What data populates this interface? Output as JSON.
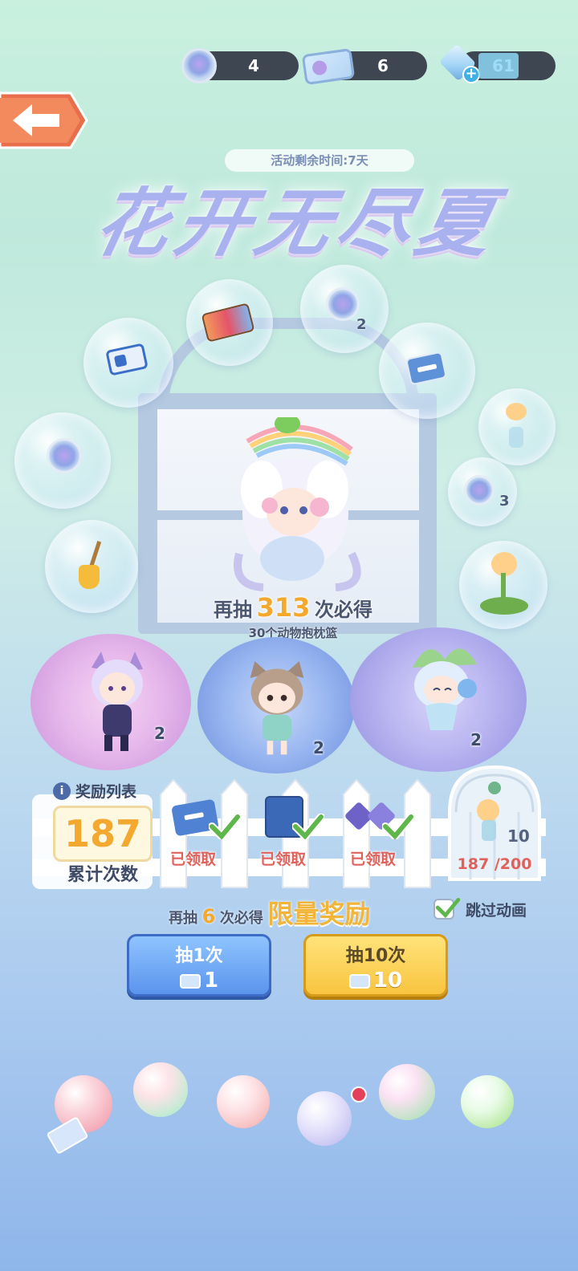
{
  "currencies": [
    {
      "name": "hydrangea-coin",
      "value": "4"
    },
    {
      "name": "draw-ticket",
      "value": "6"
    },
    {
      "name": "diamond",
      "value": "61"
    }
  ],
  "event": {
    "timer_text": "活动剩余时间:7天",
    "title": "花开无尽夏"
  },
  "bubbles": [
    {
      "icon": "ticket-icon",
      "qty": ""
    },
    {
      "icon": "ticket-pack-icon",
      "qty": ""
    },
    {
      "icon": "hydrangea-coin-icon",
      "qty": "2"
    },
    {
      "icon": "blue-ticket-icon",
      "qty": ""
    },
    {
      "icon": "hydrangea-coin-icon",
      "qty": ""
    },
    {
      "icon": "vase-flower-icon",
      "qty": ""
    },
    {
      "icon": "hydrangea-coin-icon",
      "qty": "3"
    },
    {
      "icon": "broom-icon",
      "qty": ""
    },
    {
      "icon": "flower-plant-icon",
      "qty": ""
    }
  ],
  "main_prize": {
    "pity_prefix": "再抽",
    "pity_count": "313",
    "pity_suffix": "次必得",
    "prize_name": "30个动物抱枕篮"
  },
  "featured": [
    {
      "name": "purple-fox-character",
      "qty": "2"
    },
    {
      "name": "cat-girl-character",
      "qty": "2"
    },
    {
      "name": "flower-fairy-character",
      "qty": "2"
    }
  ],
  "rewards": {
    "header": "奖励列表",
    "count": "187",
    "count_label": "累计次数",
    "items": [
      {
        "icon": "blue-ticket-icon",
        "status": "已领取"
      },
      {
        "icon": "blue-box-icon",
        "status": "已领取"
      },
      {
        "icon": "purple-bow-icon",
        "status": "已领取"
      }
    ],
    "big_reward_qty": "10",
    "big_reward_progress": "187 /200"
  },
  "limited": {
    "prefix": "再抽",
    "count": "6",
    "suffix": "次必得",
    "label": "限量奖励"
  },
  "skip_animation": "跳过动画",
  "draw_buttons": [
    {
      "label": "抽1次",
      "cost": "1"
    },
    {
      "label": "抽10次",
      "cost": "10"
    }
  ],
  "colors": {
    "accent_orange": "#f4a82c",
    "claimed_red": "#e0615a",
    "button_blue": "#5b94ec",
    "button_yellow": "#f9c43f"
  }
}
